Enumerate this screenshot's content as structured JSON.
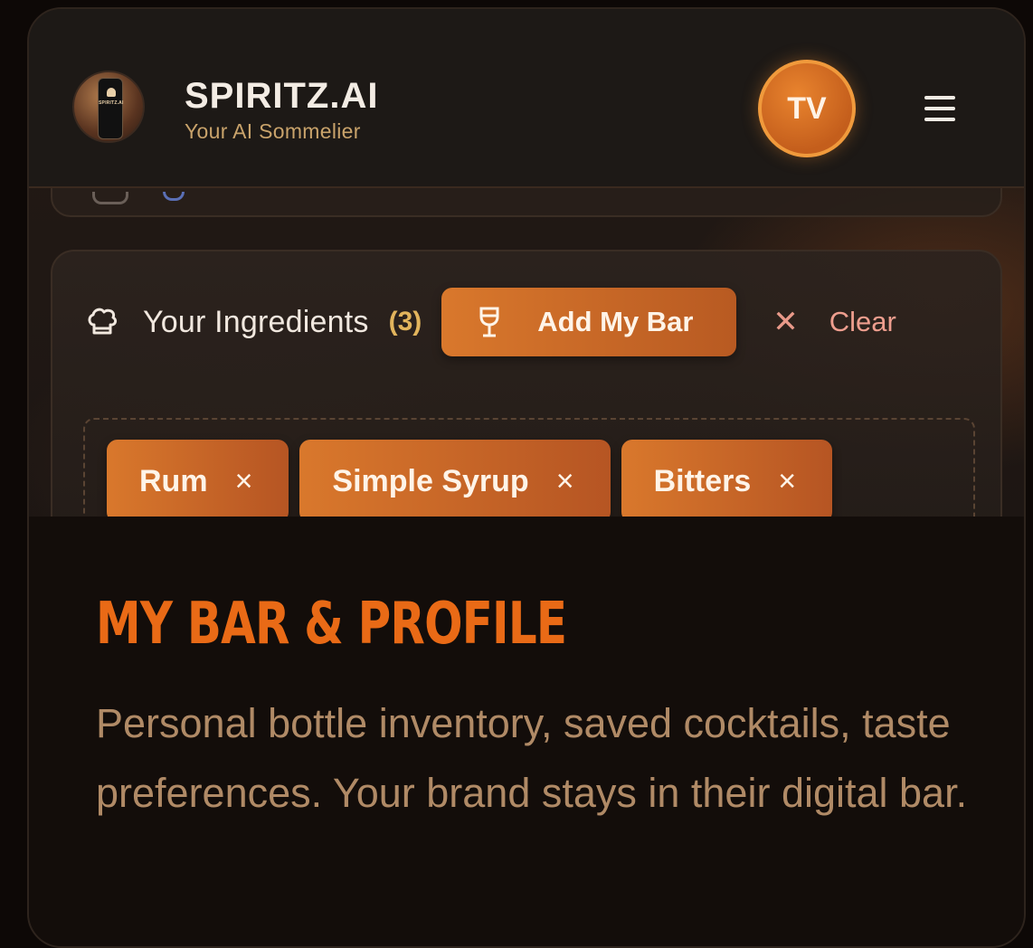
{
  "header": {
    "brand_title": "SPIRITZ.AI",
    "brand_subtitle": "Your AI Sommelier",
    "logo_label": "SPIRITZ.AI",
    "avatar_initials": "TV",
    "menu_icon": "hamburger-menu-icon"
  },
  "ingredients": {
    "icon": "chef-hat-icon",
    "title": "Your Ingredients",
    "count": "(3)",
    "add_bar_label": "Add My Bar",
    "add_bar_icon": "wine-glass-icon",
    "clear_label": "Clear",
    "clear_icon": "close-icon",
    "items": [
      {
        "label": "Rum",
        "remove_icon": "×"
      },
      {
        "label": "Simple Syrup",
        "remove_icon": "×"
      },
      {
        "label": "Bitters",
        "remove_icon": "×"
      }
    ]
  },
  "info": {
    "title": "MY BAR & PROFILE",
    "description": "Personal bottle inventory, saved cocktails, taste preferences. Your brand stays in their digital bar."
  },
  "colors": {
    "accent": "#d9782c",
    "title_orange": "#e96a16",
    "count_gold": "#e2b45c",
    "body_text": "#b08a66"
  }
}
